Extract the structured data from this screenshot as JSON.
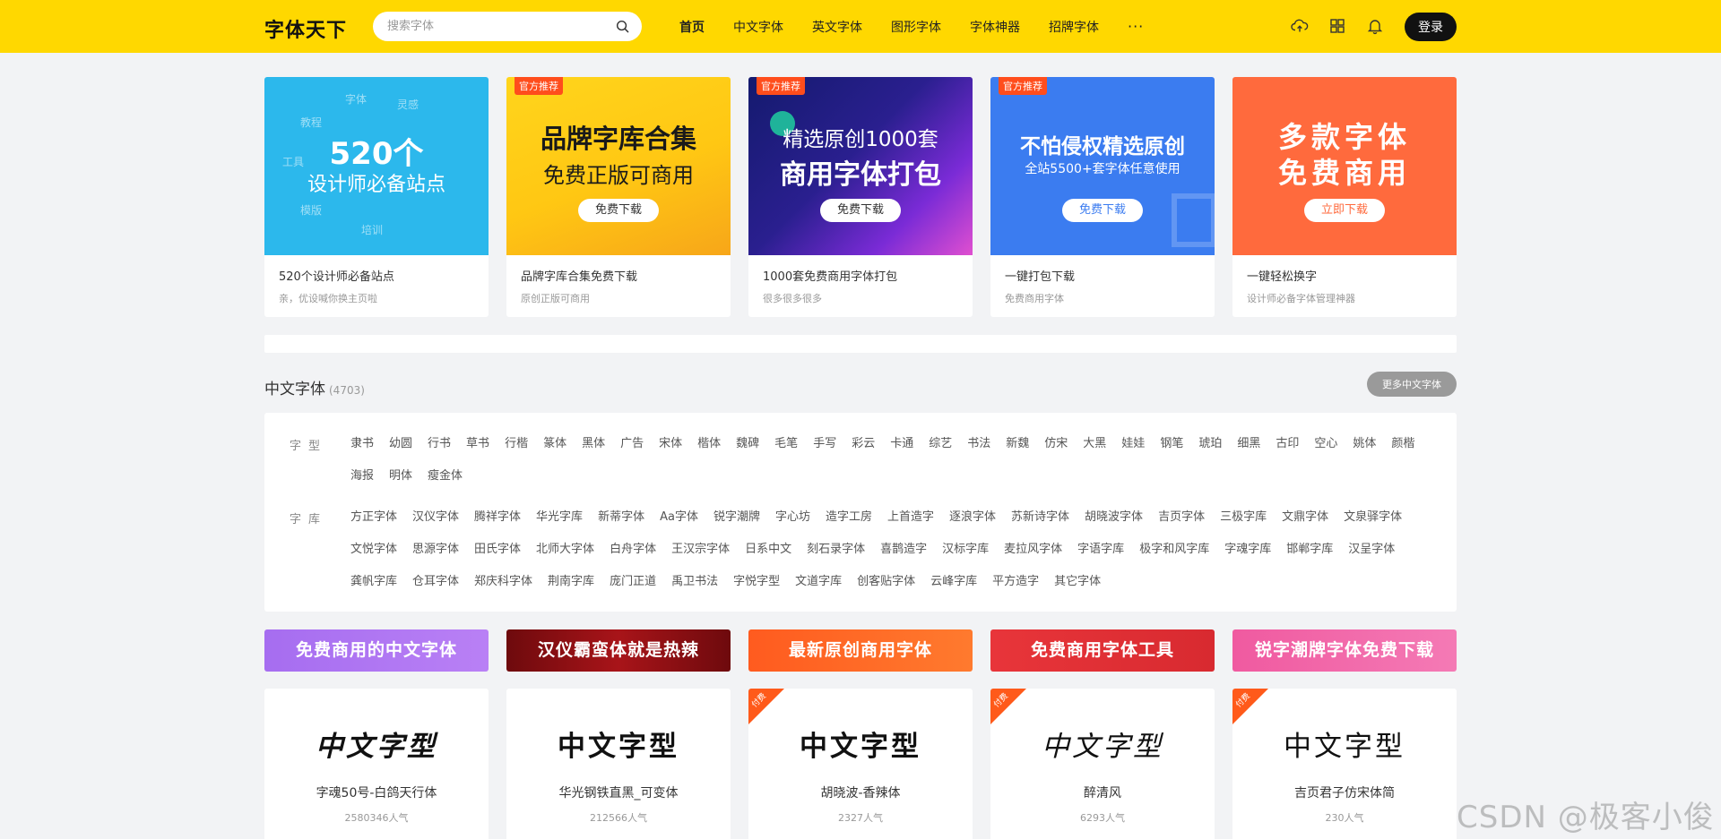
{
  "header": {
    "logo": "字体天下",
    "search_placeholder": "搜索字体",
    "nav": [
      "首页",
      "中文字体",
      "英文字体",
      "图形字体",
      "字体神器",
      "招牌字体"
    ],
    "more": "···",
    "login": "登录"
  },
  "banners": [
    {
      "tag": "",
      "line1": "520个",
      "line2": "设计师必备站点",
      "btn": "",
      "title": "520个设计师必备站点",
      "sub": "亲，优设喊你换主页啦"
    },
    {
      "tag": "官方推荐",
      "line1": "品牌字库合集",
      "line2": "免费正版可商用",
      "btn": "免费下载",
      "title": "品牌字库合集免费下载",
      "sub": "原创正版可商用"
    },
    {
      "tag": "官方推荐",
      "line1": "精选原创1000套",
      "line2": "商用字体打包",
      "btn": "免费下载",
      "title": "1000套免费商用字体打包",
      "sub": "很多很多很多"
    },
    {
      "tag": "官方推荐",
      "line1": "不怕侵权精选原创",
      "line2": "全站5500+套字体任意使用",
      "btn": "免费下载",
      "title": "一键打包下载",
      "sub": "免费商用字体"
    },
    {
      "tag": "",
      "line1": "多款字体",
      "line2": "免费商用",
      "btn": "立即下载",
      "title": "一键轻松换字",
      "sub": "设计师必备字体管理神器"
    }
  ],
  "section": {
    "title": "中文字体",
    "count": "(4703)",
    "more": "更多中文字体",
    "label_style": "字型",
    "label_library": "字库",
    "styles": [
      "隶书",
      "幼圆",
      "行书",
      "草书",
      "行楷",
      "篆体",
      "黑体",
      "广告",
      "宋体",
      "楷体",
      "魏碑",
      "毛笔",
      "手写",
      "彩云",
      "卡通",
      "综艺",
      "书法",
      "新魏",
      "仿宋",
      "大黑",
      "娃娃",
      "钢笔",
      "琥珀",
      "细黑",
      "古印",
      "空心",
      "姚体",
      "颜楷",
      "海报",
      "明体",
      "瘦金体"
    ],
    "libraries": [
      "方正字体",
      "汉仪字体",
      "腾祥字体",
      "华光字库",
      "新蒂字体",
      "Aa字体",
      "锐字潮牌",
      "字心坊",
      "造字工房",
      "上首造字",
      "逐浪字体",
      "苏新诗字体",
      "胡晓波字体",
      "吉页字体",
      "三极字库",
      "文鼎字体",
      "文泉驿字体",
      "文悦字体",
      "思源字体",
      "田氏字体",
      "北师大字体",
      "白舟字体",
      "王汉宗字体",
      "日系中文",
      "刻石录字体",
      "喜鹊造字",
      "汉标字库",
      "麦拉风字体",
      "字语字库",
      "极字和风字库",
      "字魂字库",
      "邯郸字库",
      "汉呈字体",
      "龚帆字库",
      "仓耳字体",
      "郑庆科字体",
      "荆南字库",
      "庞门正道",
      "禹卫书法",
      "字悦字型",
      "文道字库",
      "创客贴字体",
      "云峰字库",
      "平方造字",
      "其它字体"
    ]
  },
  "themes": [
    "免费商用的中文字体",
    "汉仪霸蛮体就是热辣",
    "最新原创商用字体",
    "免费商用字体工具",
    "锐字潮牌字体免费下载"
  ],
  "fonts": [
    {
      "sample": "中文字型",
      "name": "字魂50号-白鸽天行体",
      "pop": "2580346人气",
      "paid": ""
    },
    {
      "sample": "中文字型",
      "name": "华光钢铁直黑_可变体",
      "pop": "212566人气",
      "paid": ""
    },
    {
      "sample": "中文字型",
      "name": "胡晓波-香辣体",
      "pop": "2327人气",
      "paid": "付费"
    },
    {
      "sample": "中文字型",
      "name": "醉清风",
      "pop": "6293人气",
      "paid": "付费"
    },
    {
      "sample": "中文字型",
      "name": "吉页君子仿宋体简",
      "pop": "230人气",
      "paid": "付费"
    }
  ],
  "watermark": "CSDN @极客小俊",
  "colors": {
    "header_bg": "#ffd800",
    "banner_bg": [
      "#2cb8ec",
      "#ffc713",
      "#1d1f7a",
      "#3b7cf0",
      "#ff6a3d"
    ],
    "theme_bg": [
      "#a66df0",
      "#8b0f12",
      "#ff5b1f",
      "#e8353a",
      "#f05aa0"
    ],
    "paid_corner": "#ff5a1a"
  }
}
